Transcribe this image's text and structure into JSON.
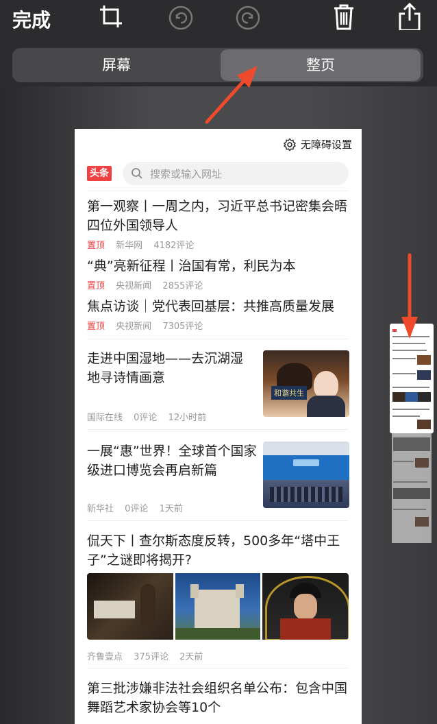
{
  "toolbar": {
    "done_label": "完成"
  },
  "segments": {
    "screen_label": "屏幕",
    "fullpage_label": "整页",
    "active": "fullpage"
  },
  "page": {
    "a11y_label": "无障碍设置",
    "logo_text": "头条",
    "search_placeholder": "搜索或输入网址",
    "top_news": [
      {
        "title": "第一观察丨一周之内，习近平总书记密集会晤四位外国领导人",
        "tag": "置顶",
        "source": "新华网",
        "comments": "4182评论"
      },
      {
        "title": "“典”亮新征程丨治国有常，利民为本",
        "tag": "置顶",
        "source": "央视新闻",
        "comments": "2855评论"
      },
      {
        "title": "焦点访谈｜党代表回基层：共推高质量发展",
        "tag": "置顶",
        "source": "央视新闻",
        "comments": "7305评论"
      }
    ],
    "news_with_image": [
      {
        "title": "走进中国湿地——去沉湖湿地寻诗情画意",
        "source": "国际在线",
        "comments": "0评论",
        "time": "12小时前",
        "thumb_text": "和谐共生"
      },
      {
        "title": "一展“惠”世界！全球首个国家级进口博览会再启新篇",
        "source": "新华社",
        "comments": "0评论",
        "time": "1天前"
      }
    ],
    "news_three_images": {
      "title": "侃天下丨查尔斯态度反转，500多年“塔中王子”之谜即将揭开?",
      "source": "齐鲁壹点",
      "comments": "375评论",
      "time": "2天前"
    },
    "last_news": {
      "title": "第三批涉嫌非法社会组织名单公布：包含中国舞蹈艺术家协会等10个"
    }
  },
  "colors": {
    "arrow": "#f04a2c",
    "brand_red": "#f04142"
  }
}
